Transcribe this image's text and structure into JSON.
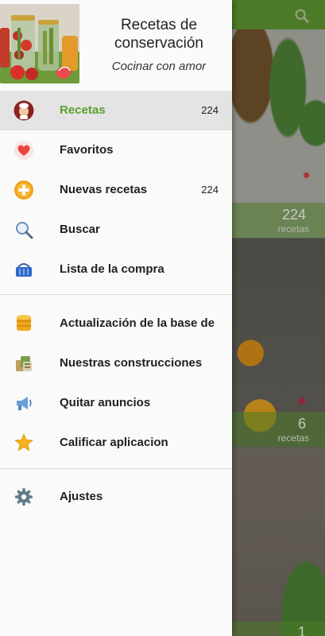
{
  "header": {
    "title": "Recetas de conservación",
    "subtitle": "Cocinar con amor"
  },
  "menu": {
    "section1": [
      {
        "label": "Recetas",
        "count": "224",
        "icon": "chef-icon",
        "active": true
      },
      {
        "label": "Favoritos",
        "count": "",
        "icon": "heart-icon"
      },
      {
        "label": "Nuevas recetas",
        "count": "224",
        "icon": "plus-icon"
      },
      {
        "label": "Buscar",
        "count": "",
        "icon": "magnifier-icon"
      },
      {
        "label": "Lista de la compra",
        "count": "",
        "icon": "basket-icon"
      }
    ],
    "section2": [
      {
        "label": "Actualización de la base de",
        "icon": "database-icon"
      },
      {
        "label": "Nuestras construcciones",
        "icon": "apps-icon"
      },
      {
        "label": "Quitar anuncios",
        "icon": "megaphone-icon"
      },
      {
        "label": "Calificar aplicacion",
        "icon": "star-icon"
      }
    ],
    "section3": [
      {
        "label": "Ajustes",
        "icon": "gear-icon"
      }
    ]
  },
  "background": {
    "cards": [
      {
        "count": "224",
        "label": "recetas"
      },
      {
        "count": "6",
        "label": "recetas"
      },
      {
        "count": "1",
        "label": ""
      }
    ]
  },
  "colors": {
    "accent": "#5aa12c",
    "app_bar": "#4d7a27"
  }
}
